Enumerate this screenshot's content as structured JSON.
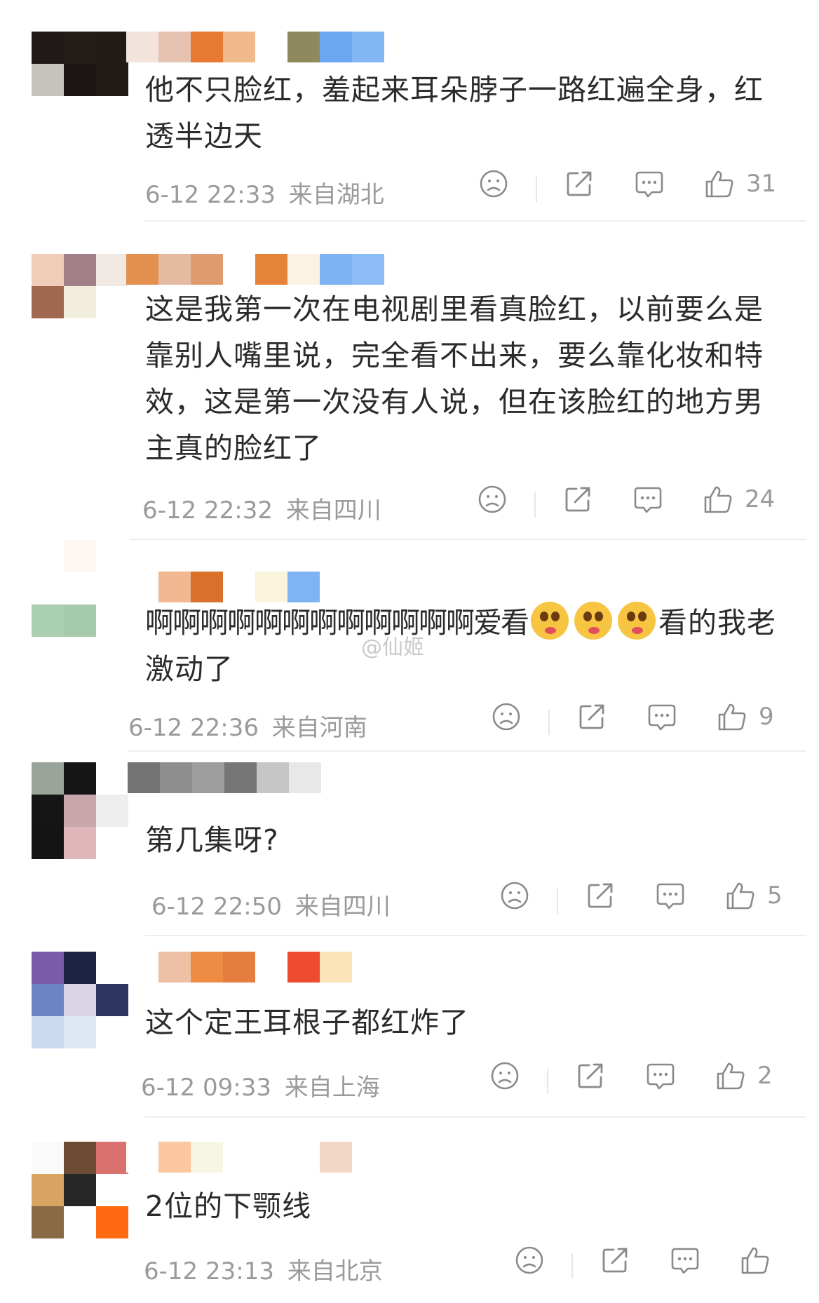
{
  "comments": [
    {
      "avatar": [
        "#1f1a17",
        "#231c18",
        "#211a16",
        "#c6c3bc",
        "#1c1714",
        "#231b17",
        "#ffffff",
        "#ffffff",
        "#ffffff"
      ],
      "username_blocks": [
        "#f2e4dc",
        "#e5c3b0",
        "#e77b31",
        "#f0b98c",
        "#ffffff",
        "#8e8a5e",
        "#6aa7ef",
        "#82b6f4"
      ],
      "text": "他不只脸红，羞起来耳朵脖子一路红遍全身，红透半边天",
      "time": "6-12 22:33",
      "location": "来自湖北",
      "likes": "31"
    },
    {
      "avatar": [
        "#efcdb9",
        "#a07f88",
        "#f0e8e3",
        "#a0694f",
        "#f2eedd",
        "#ffffff",
        "#ffffff",
        "#ffffff",
        "#ffffff"
      ],
      "username_blocks": [
        "#e4914f",
        "#e4baa0",
        "#df9b6f",
        "#ffffff",
        "#e58438",
        "#fcf2e4",
        "#7fb2f3",
        "#8cbcf5"
      ],
      "text": "这是我第一次在电视剧里看真脸红，以前要么是靠别人嘴里说，完全看不出来，要么靠化妆和特效，这是第一次没有人说，但在该脸红的地方男主真的脸红了",
      "time": "6-12 22:32",
      "location": "来自四川",
      "likes": "24"
    },
    {
      "avatar": [
        "#ffffff",
        "#fdf8f3",
        "#ffffff",
        "#ffffff",
        "#ffffff",
        "#ffffff",
        "#a9ceb0",
        "#a6cbab",
        "#ffffff"
      ],
      "username_blocks": [
        "#ffffff",
        "#f2b891",
        "#d9712b",
        "#ffffff",
        "#fbf4dc",
        "#7fb3f3"
      ],
      "text_before": "啊啊啊啊啊啊啊啊啊啊啊啊爱看",
      "emojis": [
        "blush-emoji",
        "blush-emoji",
        "blush-emoji"
      ],
      "text_after": "看的我老激动了",
      "time": "6-12 22:36",
      "location": "来自河南",
      "likes": "9",
      "watermark": "@仙姬"
    },
    {
      "avatar": [
        "#9ba49a",
        "#161616",
        "#ffffff",
        "#151515",
        "#c9a6ac",
        "#eeeeee",
        "#141414",
        "#dfb6b9",
        "#ffffff"
      ],
      "username_blocks": [
        "#737373",
        "#8e8e8e",
        "#9d9d9d",
        "#767676",
        "#c6c6c6",
        "#e8e8e8"
      ],
      "text": "第几集呀?",
      "time": "6-12 22:50",
      "location": "来自四川",
      "likes": "5"
    },
    {
      "avatar": [
        "#7a5aa9",
        "#1f2442",
        "#ffffff",
        "#6c84c4",
        "#d9d3e6",
        "#2d3561",
        "#cbdaef",
        "#dfe7f5",
        "#ffffff"
      ],
      "username_blocks": [
        "#ffffff",
        "#eec1a6",
        "#ee8c44",
        "#e57c40",
        "#ffffff",
        "#ef4b31",
        "#fbe4b8"
      ],
      "text": "这个定王耳根子都红炸了",
      "time": "6-12 09:33",
      "location": "来自上海",
      "likes": "2"
    },
    {
      "avatar": [
        "#fafafa",
        "#6b4b34",
        "#d9726f",
        "#d9a462",
        "#272727",
        "#ffffff",
        "#8a6945",
        "#ffffff",
        "#ff6a13"
      ],
      "username_blocks": [
        "#ffffff",
        "#fcc79e",
        "#f6f6e2",
        "#ffffff",
        "#ffffff",
        "#ffffff",
        "#f2d7c5"
      ],
      "text": "2位的下颚线",
      "time": "6-12 23:13",
      "location": "来自北京",
      "likes": ""
    }
  ],
  "icons": [
    "dislike-icon",
    "share-icon",
    "comment-icon",
    "like-icon"
  ]
}
